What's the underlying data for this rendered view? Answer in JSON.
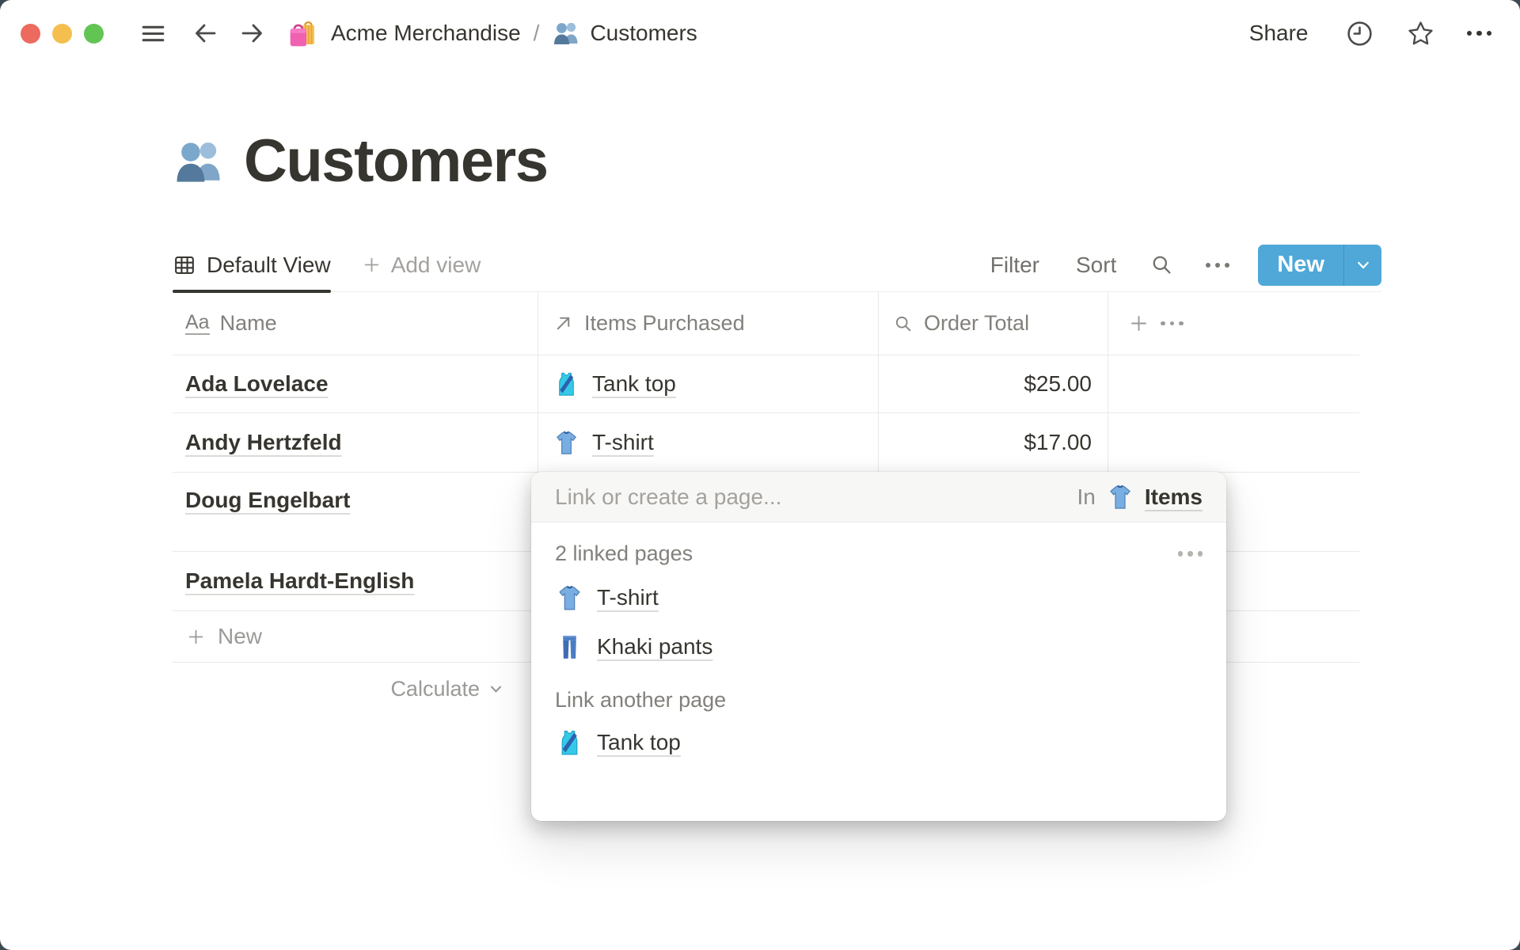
{
  "topbar": {
    "breadcrumb": {
      "workspace_icon": "shopping-bags-icon",
      "workspace": "Acme Merchandise",
      "separator": "/",
      "page_icon": "busts-icon",
      "page": "Customers"
    },
    "share_label": "Share",
    "icons": [
      "hamburger-icon",
      "arrow-left-icon",
      "arrow-right-icon",
      "clock-icon",
      "star-icon",
      "ellipsis-icon"
    ]
  },
  "page": {
    "icon": "busts-icon",
    "title": "Customers"
  },
  "toolbar": {
    "active_view": {
      "icon": "table-view-icon",
      "label": "Default View"
    },
    "add_view_label": "Add view",
    "filter_label": "Filter",
    "sort_label": "Sort",
    "search_icon": "search-icon",
    "more_icon": "ellipsis-icon",
    "new_button": {
      "label": "New",
      "color": "#4FA8D8",
      "caret_icon": "chevron-down-icon"
    }
  },
  "table": {
    "columns": [
      {
        "label": "Name",
        "icon": "title-icon",
        "icon_text": "Aa"
      },
      {
        "label": "Items Purchased",
        "icon": "relation-arrow-icon"
      },
      {
        "label": "Order Total",
        "icon": "rollup-search-icon"
      }
    ],
    "rows": [
      {
        "name": "Ada Lovelace",
        "item": "Tank top",
        "item_icon": "tank-top-icon",
        "order_total": "$25.00"
      },
      {
        "name": "Andy Hertzfeld",
        "item": "T-shirt",
        "item_icon": "t-shirt-icon",
        "order_total": "$17.00"
      },
      {
        "name": "Doug Engelbart",
        "item": "",
        "item_icon": "",
        "order_total": ""
      },
      {
        "name": "Pamela Hardt-English",
        "item": "",
        "item_icon": "",
        "order_total": ""
      }
    ],
    "new_row_label": "New",
    "calculate_label": "Calculate"
  },
  "popup": {
    "placeholder": "Link or create a page...",
    "in_label": "In",
    "in_page": {
      "icon": "t-shirt-icon",
      "label": "Items"
    },
    "linked_count_label": "2 linked pages",
    "linked_pages": [
      {
        "icon": "t-shirt-icon",
        "label": "T-shirt"
      },
      {
        "icon": "jeans-icon",
        "label": "Khaki pants"
      }
    ],
    "link_another_label": "Link another page",
    "suggestions": [
      {
        "icon": "tank-top-icon",
        "label": "Tank top"
      }
    ]
  },
  "colors": {
    "accent_blue": "#4FA8D8",
    "text_dark": "#37352F",
    "text_gray": "#82807B",
    "divider": "#E9E9E7"
  }
}
